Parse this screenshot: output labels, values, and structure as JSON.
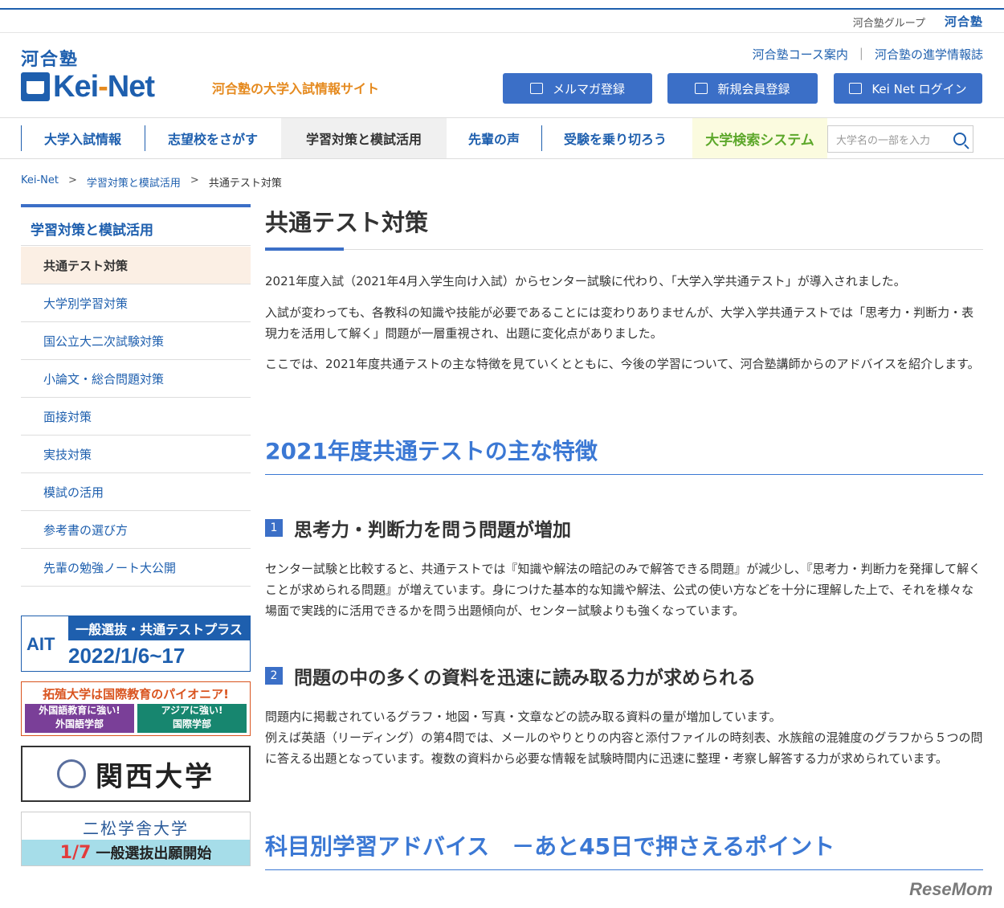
{
  "group_bar": {
    "text": "河合塾グループ",
    "logo": "河合塾"
  },
  "header": {
    "kawai_label": "河合塾",
    "logo_left": "Kei",
    "logo_dash": "-",
    "logo_right": "Net",
    "tagline": "河合塾の大学入試情報サイト",
    "links": [
      "河合塾コース案内",
      "河合塾の進学情報誌"
    ],
    "buttons": {
      "mail": "メルマガ登録",
      "register": "新規会員登録",
      "login": "Kei Net ログイン"
    }
  },
  "nav": {
    "items": [
      "大学入試情報",
      "志望校をさがす",
      "学習対策と模試活用",
      "先輩の声",
      "受験を乗り切ろう"
    ],
    "search_label": "大学検索システム",
    "search_placeholder": "大学名の一部を入力"
  },
  "breadcrumb": [
    "Kei-Net",
    "学習対策と模試活用",
    "共通テスト対策"
  ],
  "sidebar": {
    "heading": "学習対策と模試活用",
    "items": [
      "共通テスト対策",
      "大学別学習対策",
      "国公立大二次試験対策",
      "小論文・総合問題対策",
      "面接対策",
      "実技対策",
      "模試の活用",
      "参考書の選び方",
      "先輩の勉強ノート大公開"
    ]
  },
  "banners": {
    "ait": {
      "logo": "AIT",
      "title": "一般選抜・共通テストプラス",
      "date": "2022/1/6~17"
    },
    "takushoku": {
      "title": "拓殖大学は国際教育のパイオニア!",
      "left": "外国語教育に強い!\n外国語学部",
      "right": "アジアに強い!\n国際学部"
    },
    "kansai": {
      "name": "関西大学"
    },
    "nishogakusha": {
      "name": "二松学舎大学",
      "date": "1/7",
      "text": "一般選抜出願開始"
    }
  },
  "main": {
    "title": "共通テスト対策",
    "intro": [
      "2021年度入試（2021年4月入学生向け入試）からセンター試験に代わり、「大学入学共通テスト」が導入されました。",
      "入試が変わっても、各教科の知識や技能が必要であることには変わりありませんが、大学入学共通テストでは「思考力・判断力・表現力を活用して解く」問題が一層重視され、出題に変化点がありました。",
      "ここでは、2021年度共通テストの主な特徴を見ていくとともに、今後の学習について、河合塾講師からのアドバイスを紹介します。"
    ],
    "section1_title": "2021年度共通テストの主な特徴",
    "point1": {
      "num": "1",
      "title": "思考力・判断力を問う問題が増加",
      "body": "センター試験と比較すると、共通テストでは『知識や解法の暗記のみで解答できる問題』が減少し、『思考力・判断力を発揮して解くことが求められる問題』が増えています。身につけた基本的な知識や解法、公式の使い方などを十分に理解した上で、それを様々な場面で実践的に活用できるかを問う出題傾向が、センター試験よりも強くなっています。"
    },
    "point2": {
      "num": "2",
      "title": "問題の中の多くの資料を迅速に読み取る力が求められる",
      "body1": "問題内に掲載されているグラフ・地図・写真・文章などの読み取る資料の量が増加しています。",
      "body2": "例えば英語（リーディング）の第4問では、メールのやりとりの内容と添付ファイルの時刻表、水族館の混雑度のグラフから５つの問に答える出題となっています。複数の資料から必要な情報を試験時間内に迅速に整理・考察し解答する力が求められています。"
    },
    "section2_title": "科目別学習アドバイス　－あと45日で押さえるポイント"
  },
  "watermark": "ReseMom"
}
